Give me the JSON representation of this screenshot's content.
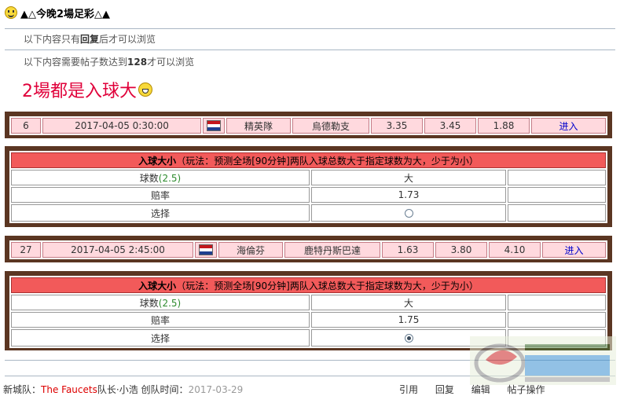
{
  "thread": {
    "title": "▲△今晚2場足彩△▲",
    "notice_reply_prefix": "以下内容只有",
    "notice_reply_bold": "回复",
    "notice_reply_suffix": "后才可以浏览",
    "notice_posts_prefix": "以下内容需要帖子数达到",
    "notice_posts_bold": "128",
    "notice_posts_suffix": "才可以浏览",
    "headline": "2場都是入球大"
  },
  "matches": [
    {
      "no": "6",
      "datetime": "2017-04-05 0:30:00",
      "home": "精英隊",
      "away": "烏德勒支",
      "odd1": "3.35",
      "odd2": "3.45",
      "odd3": "1.88",
      "action": "进入",
      "bet": {
        "header_bold": "入球大小",
        "header_rule": "（玩法：预测全场[90分钟]两队入球总数大于指定球数为大，少于为小）",
        "line_label": "球数",
        "line_value": "(2.5)",
        "option": "大",
        "odds_label": "赔率",
        "odds_value": "1.73",
        "select_label": "选择",
        "selected": false
      }
    },
    {
      "no": "27",
      "datetime": "2017-04-05 2:45:00",
      "home": "海倫芬",
      "away": "鹿特丹斯巴達",
      "odd1": "1.63",
      "odd2": "3.80",
      "odd3": "4.10",
      "action": "进入",
      "bet": {
        "header_bold": "入球大小",
        "header_rule": "（玩法：预测全场[90分钟]两队入球总数大于指定球数为大，少于为小）",
        "line_label": "球数",
        "line_value": "(2.5)",
        "option": "大",
        "odds_label": "赔率",
        "odds_value": "1.75",
        "select_label": "选择",
        "selected": true
      }
    }
  ],
  "footer": {
    "prefix": "新城队：",
    "team": "The Faucets",
    "role": "队长",
    "sep": "·",
    "extra": "小浩",
    "created_label": "创队时间：",
    "created_value": "2017-03-29",
    "actions": [
      "引用",
      "回复",
      "编辑",
      "帖子操作"
    ]
  }
}
